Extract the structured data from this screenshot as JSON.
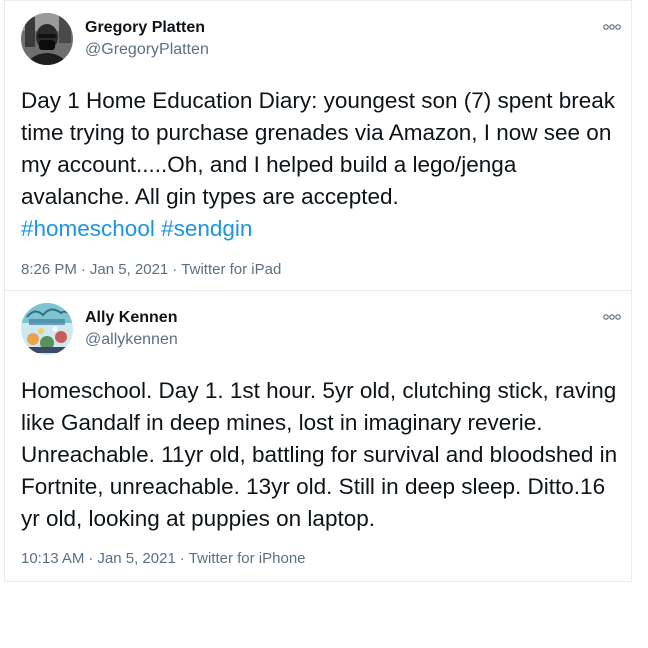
{
  "tweets": [
    {
      "display_name": "Gregory Platten",
      "handle": "@GregoryPlatten",
      "text": "Day 1 Home Education Diary: youngest son (7) spent break time trying to purchase grenades via Amazon,  I now see on my account.....Oh, and I helped build a lego/jenga avalanche. All gin types are accepted.",
      "hashtags": [
        "#homeschool",
        "#sendgin"
      ],
      "time": "8:26 PM",
      "date": "Jan 5, 2021",
      "separator": "·",
      "source": "Twitter for iPad",
      "avatar_icon": "person-with-mask-avatar"
    },
    {
      "display_name": "Ally Kennen",
      "handle": "@allykennen",
      "text": "Homeschool. Day 1. 1st hour. 5yr old, clutching stick, raving like Gandalf in deep mines, lost in imaginary reverie. Unreachable. 11yr old, battling for survival and bloodshed in Fortnite, unreachable. 13yr old. Still in deep sleep. Ditto.16 yr old, looking at puppies on laptop.",
      "time": "10:13 AM",
      "date": "Jan 5, 2021",
      "separator": "·",
      "source": "Twitter for iPhone",
      "avatar_icon": "illustrated-book-cover-avatar"
    }
  ],
  "colors": {
    "text": "#0f1419",
    "muted": "#5b7083",
    "link": "#1b95e0",
    "border": "#e6ecf0"
  },
  "icons": {
    "more": "more-options-icon"
  }
}
